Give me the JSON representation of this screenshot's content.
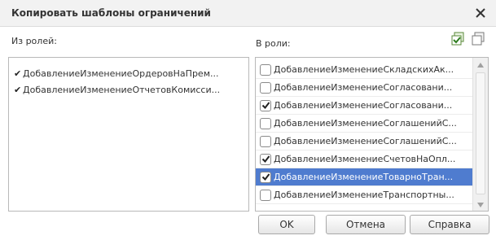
{
  "window": {
    "title": "Копировать шаблоны ограничений",
    "close_icon": "close-icon"
  },
  "from_roles": {
    "label": "Из ролей:",
    "items": [
      {
        "mark": "✔",
        "label": "ДобавлениеИзменениеОрдеровНаПрем..."
      },
      {
        "mark": "✔",
        "label": "ДобавлениеИзменениеОтчетовКомисси..."
      }
    ]
  },
  "to_roles": {
    "label": "В роли:",
    "check_all_icon": "check-all-icon",
    "uncheck_all_icon": "uncheck-all-icon",
    "items": [
      {
        "label": "ДобавлениеИзменениеСкладскихАк...",
        "checked": false,
        "selected": false
      },
      {
        "label": "ДобавлениеИзменениеСогласовани...",
        "checked": false,
        "selected": false
      },
      {
        "label": "ДобавлениеИзменениеСогласовани...",
        "checked": true,
        "selected": false
      },
      {
        "label": "ДобавлениеИзменениеСоглашенийС...",
        "checked": false,
        "selected": false
      },
      {
        "label": "ДобавлениеИзменениеСоглашенийС...",
        "checked": false,
        "selected": false
      },
      {
        "label": "ДобавлениеИзменениеСчетовНаОпл...",
        "checked": true,
        "selected": false
      },
      {
        "label": "ДобавлениеИзменениеТоварноТран...",
        "checked": true,
        "selected": true
      },
      {
        "label": "ДобавлениеИзменениеТранспортны...",
        "checked": false,
        "selected": false
      }
    ]
  },
  "buttons": {
    "ok": "OK",
    "cancel": "Отмена",
    "help": "Справка"
  },
  "colors": {
    "selection": "#4f7ccf",
    "titlebar": "#f2f2f2"
  }
}
